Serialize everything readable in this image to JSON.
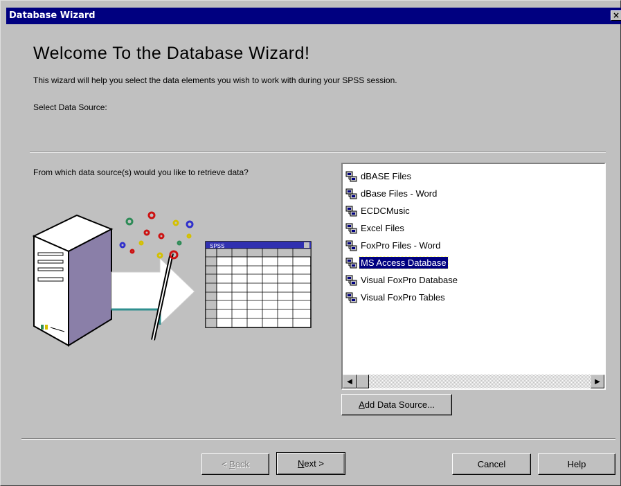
{
  "window": {
    "title": "Database Wizard",
    "close_glyph": "×"
  },
  "page": {
    "heading": "Welcome To the Database Wizard!",
    "intro": "This wizard will help you select the data elements you wish to work with during your SPSS session.",
    "select_label": "Select Data Source:",
    "question": "From which data source(s) would you like to retrieve data?"
  },
  "illustration": {
    "table_title": "SPSS"
  },
  "datasources": [
    {
      "label": "dBASE Files",
      "icon": "database-icon",
      "selected": false
    },
    {
      "label": "dBase Files - Word",
      "icon": "database-icon",
      "selected": false
    },
    {
      "label": "ECDCMusic",
      "icon": "database-icon",
      "selected": false
    },
    {
      "label": "Excel Files",
      "icon": "database-icon",
      "selected": false
    },
    {
      "label": "FoxPro Files - Word",
      "icon": "database-icon",
      "selected": false
    },
    {
      "label": "MS Access Database",
      "icon": "database-icon",
      "selected": true
    },
    {
      "label": "Visual FoxPro Database",
      "icon": "database-icon",
      "selected": false
    },
    {
      "label": "Visual FoxPro Tables",
      "icon": "database-icon",
      "selected": false
    }
  ],
  "buttons": {
    "add_data_source": {
      "mnemonic": "A",
      "rest": "dd Data Source..."
    },
    "back": {
      "prefix": "< ",
      "mnemonic": "B",
      "rest": "ack"
    },
    "next": {
      "mnemonic": "N",
      "rest": "ext >"
    },
    "cancel": "Cancel",
    "help": "Help"
  },
  "colors": {
    "face": "#c0c0c0",
    "title": "#000080",
    "selection": "#000080"
  }
}
